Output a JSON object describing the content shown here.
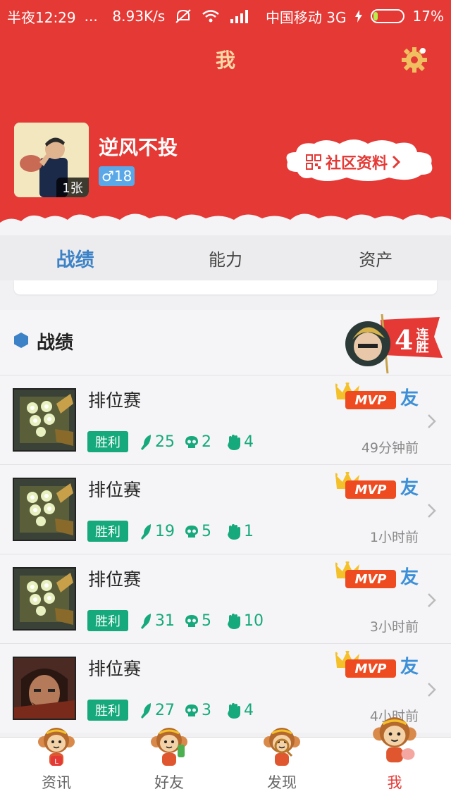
{
  "status_bar": {
    "time": "半夜12:29",
    "dots": "...",
    "speed": "8.93K/s",
    "carrier": "中国移动 3G",
    "battery": "17%",
    "battery_level": 0.17
  },
  "header": {
    "title": "我",
    "username": "逆风不投",
    "photo_count": "1张",
    "gender_age": "♂18",
    "community_button": "社区资料"
  },
  "tabs": [
    {
      "label": "战绩",
      "active": true
    },
    {
      "label": "能力",
      "active": false
    },
    {
      "label": "资产",
      "active": false
    }
  ],
  "section": {
    "title": "战绩",
    "streak_number": "4",
    "streak_word": "连胜"
  },
  "matches": [
    {
      "type": "排位赛",
      "result": "胜利",
      "kills": "25",
      "deaths": "2",
      "assists": "4",
      "mvp": "MVP",
      "friend": "友",
      "time": "49分钟前",
      "hero": "mecha"
    },
    {
      "type": "排位赛",
      "result": "胜利",
      "kills": "19",
      "deaths": "5",
      "assists": "1",
      "mvp": "MVP",
      "friend": "友",
      "time": "1小时前",
      "hero": "mecha"
    },
    {
      "type": "排位赛",
      "result": "胜利",
      "kills": "31",
      "deaths": "5",
      "assists": "10",
      "mvp": "MVP",
      "friend": "友",
      "time": "3小时前",
      "hero": "mecha"
    },
    {
      "type": "排位赛",
      "result": "胜利",
      "kills": "27",
      "deaths": "3",
      "assists": "4",
      "mvp": "MVP",
      "friend": "友",
      "time": "4小时前",
      "hero": "graves"
    }
  ],
  "bottom_nav": [
    {
      "label": "资讯",
      "icon": "monkey-news-icon",
      "active": false
    },
    {
      "label": "好友",
      "icon": "monkey-friends-icon",
      "active": false
    },
    {
      "label": "发现",
      "icon": "monkey-discover-icon",
      "active": false
    },
    {
      "label": "我",
      "icon": "monkey-me-icon",
      "active": true
    }
  ],
  "colors": {
    "brand_red": "#e53935",
    "tab_active": "#3c82c6",
    "win_green": "#16a97b",
    "mvp_orange": "#ef4b20",
    "friend_blue": "#3d90d8"
  }
}
